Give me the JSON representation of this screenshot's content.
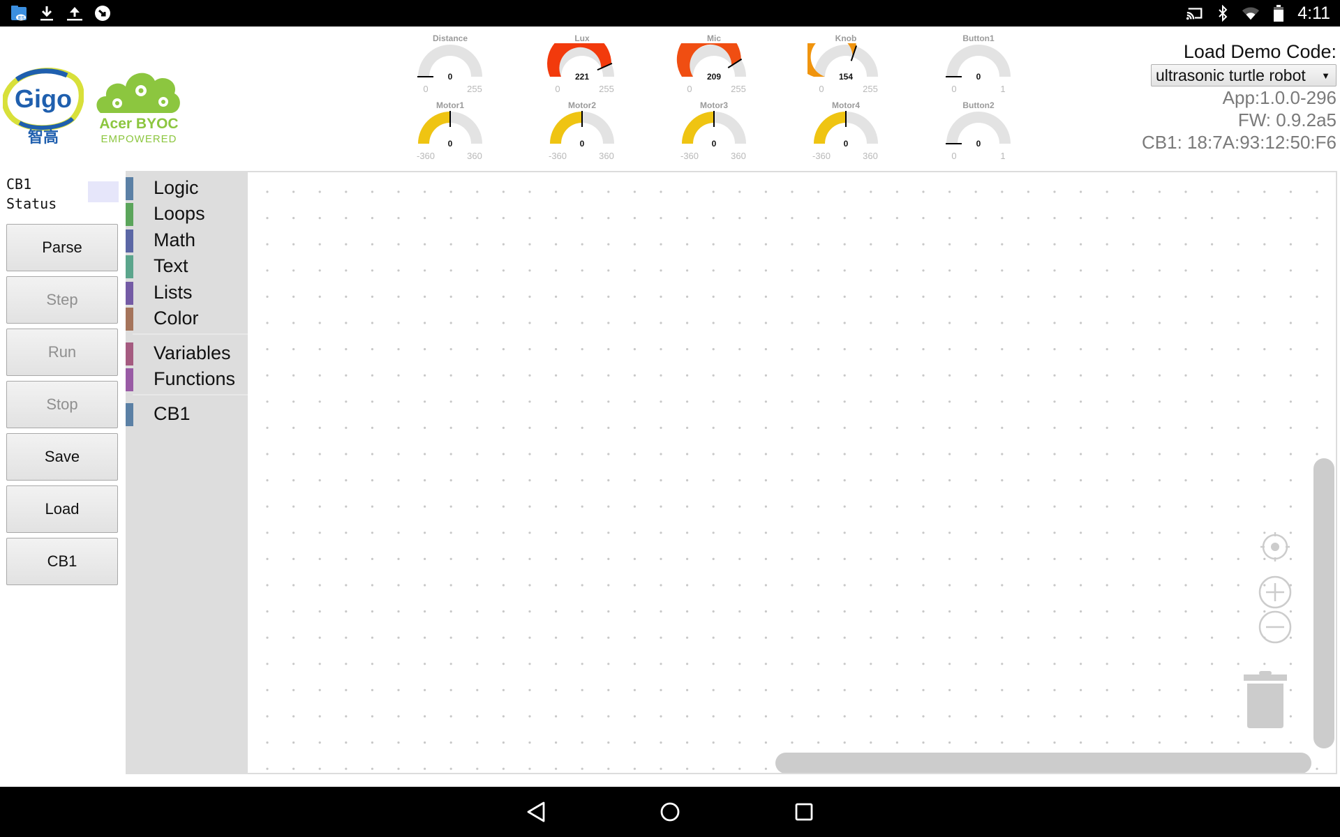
{
  "status_bar": {
    "left_icons": [
      "file-manager-icon",
      "download-icon",
      "upload-icon",
      "sync-icon"
    ],
    "right_icons": [
      "cast-icon",
      "bluetooth-icon",
      "wifi-icon",
      "battery-icon"
    ],
    "time": "4:11"
  },
  "logos": {
    "gigo": {
      "text": "Gigo",
      "subtitle": "智高"
    },
    "acer": {
      "line1": "Acer BYOC",
      "line2": "EMPOWERED"
    }
  },
  "gauges": [
    {
      "id": "distance",
      "title": "Distance",
      "value": 0,
      "min": 0,
      "max": 255,
      "color": "#e0e0e0"
    },
    {
      "id": "lux",
      "title": "Lux",
      "value": 221,
      "min": 0,
      "max": 255,
      "color": "#f23a0c"
    },
    {
      "id": "mic",
      "title": "Mic",
      "value": 209,
      "min": 0,
      "max": 255,
      "color": "#f04e12"
    },
    {
      "id": "knob",
      "title": "Knob",
      "value": 154,
      "min": 0,
      "max": 255,
      "color": "#f0940e"
    },
    {
      "id": "button1",
      "title": "Button1",
      "value": 0,
      "min": 0,
      "max": 1,
      "color": "#e0e0e0"
    },
    {
      "id": "motor1",
      "title": "Motor1",
      "value": 0,
      "min": -360,
      "max": 360,
      "color": "#efc412"
    },
    {
      "id": "motor2",
      "title": "Motor2",
      "value": 0,
      "min": -360,
      "max": 360,
      "color": "#efc412"
    },
    {
      "id": "motor3",
      "title": "Motor3",
      "value": 0,
      "min": -360,
      "max": 360,
      "color": "#efc412"
    },
    {
      "id": "motor4",
      "title": "Motor4",
      "value": 0,
      "min": -360,
      "max": 360,
      "color": "#efc412"
    },
    {
      "id": "button2",
      "title": "Button2",
      "value": 0,
      "min": 0,
      "max": 1,
      "color": "#e0e0e0"
    }
  ],
  "info": {
    "load_demo_label": "Load Demo Code:",
    "demo_selected": "ultrasonic turtle robot",
    "app_version": "App:1.0.0-296",
    "fw_version": "FW: 0.9.2a5",
    "cb1_address": "CB1: 18:7A:93:12:50:F6"
  },
  "left_panel": {
    "status_label_line1": "CB1",
    "status_label_line2": "Status",
    "status_color": "#e6e6fa",
    "buttons": [
      {
        "label": "Parse",
        "enabled": true
      },
      {
        "label": "Step",
        "enabled": false
      },
      {
        "label": "Run",
        "enabled": false
      },
      {
        "label": "Stop",
        "enabled": false
      },
      {
        "label": "Save",
        "enabled": true
      },
      {
        "label": "Load",
        "enabled": true
      },
      {
        "label": "CB1",
        "enabled": true
      }
    ]
  },
  "toolbox": {
    "categories": [
      {
        "label": "Logic",
        "color": "#5b80a5"
      },
      {
        "label": "Loops",
        "color": "#5ba55b"
      },
      {
        "label": "Math",
        "color": "#5b67a5"
      },
      {
        "label": "Text",
        "color": "#5ba58c"
      },
      {
        "label": "Lists",
        "color": "#745ba5"
      },
      {
        "label": "Color",
        "color": "#a5745b"
      },
      {
        "label": "Variables",
        "color": "#a55b80"
      },
      {
        "label": "Functions",
        "color": "#995ba5"
      },
      {
        "label": "CB1",
        "color": "#5b80a5"
      }
    ]
  },
  "workspace": {
    "controls": [
      "recenter-icon",
      "zoom-in-icon",
      "zoom-out-icon",
      "trash-icon"
    ]
  },
  "nav_bar": {
    "buttons": [
      "back-icon",
      "home-icon",
      "recents-icon"
    ]
  }
}
